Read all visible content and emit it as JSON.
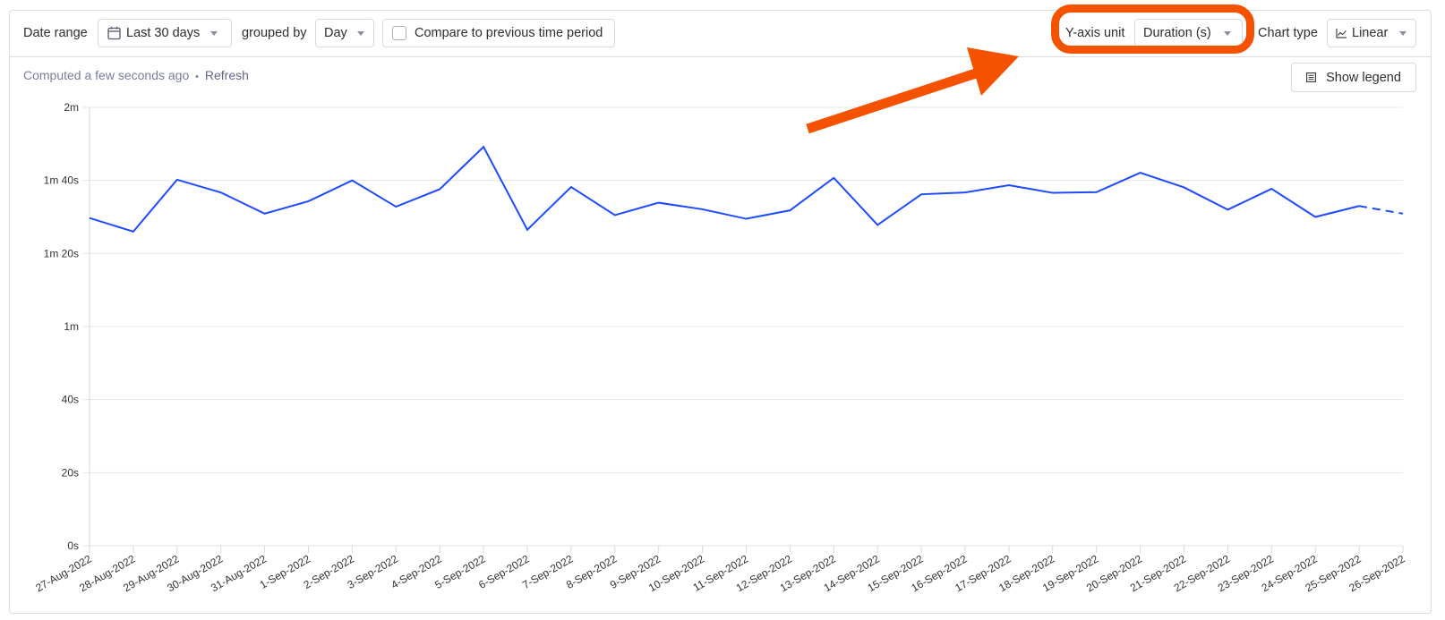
{
  "toolbar": {
    "date_range_label": "Date range",
    "date_range_value": "Last 30 days",
    "grouped_by_label": "grouped by",
    "grouped_by_value": "Day",
    "compare_label": "Compare to previous time period",
    "compare_checked": false,
    "y_axis_unit_label": "Y-axis unit",
    "y_axis_unit_value": "Duration (s)",
    "chart_type_label": "Chart type",
    "chart_type_value": "Linear"
  },
  "status": {
    "computed_text": "Computed a few seconds ago",
    "separator": "•",
    "refresh_label": "Refresh"
  },
  "legend_button_label": "Show legend",
  "annotation": {
    "color": "#f55200",
    "highlight_target": "y-axis-unit-dropdown"
  },
  "colors": {
    "series": "#1d4aff",
    "grid": "#e4e4e4",
    "axis": "#d9d9d9"
  },
  "chart_data": {
    "type": "line",
    "title": "",
    "xlabel": "",
    "ylabel": "",
    "ylim": [
      0,
      120
    ],
    "y_unit": "seconds",
    "yticks": [
      0,
      20,
      40,
      60,
      80,
      100,
      120
    ],
    "ytick_labels": [
      "0s",
      "20s",
      "40s",
      "1m",
      "1m 20s",
      "1m 40s",
      "2m"
    ],
    "grid": true,
    "legend": "hidden",
    "categories": [
      "27-Aug-2022",
      "28-Aug-2022",
      "29-Aug-2022",
      "30-Aug-2022",
      "31-Aug-2022",
      "1-Sep-2022",
      "2-Sep-2022",
      "3-Sep-2022",
      "4-Sep-2022",
      "5-Sep-2022",
      "6-Sep-2022",
      "7-Sep-2022",
      "8-Sep-2022",
      "9-Sep-2022",
      "10-Sep-2022",
      "11-Sep-2022",
      "12-Sep-2022",
      "13-Sep-2022",
      "14-Sep-2022",
      "15-Sep-2022",
      "16-Sep-2022",
      "17-Sep-2022",
      "18-Sep-2022",
      "19-Sep-2022",
      "20-Sep-2022",
      "21-Sep-2022",
      "22-Sep-2022",
      "23-Sep-2022",
      "24-Sep-2022",
      "25-Sep-2022",
      "26-Sep-2022"
    ],
    "series": [
      {
        "name": "Duration",
        "values": [
          89.7,
          86.0,
          100.2,
          96.7,
          90.9,
          94.3,
          100.0,
          92.8,
          97.6,
          109.2,
          86.5,
          98.2,
          90.5,
          93.9,
          92.1,
          89.5,
          91.8,
          100.7,
          87.8,
          96.2,
          96.7,
          98.7,
          96.6,
          96.8,
          102.1,
          98.1,
          92.0,
          97.7,
          90.0,
          93.0,
          90.9
        ],
        "incomplete_from_index": 29
      }
    ]
  }
}
